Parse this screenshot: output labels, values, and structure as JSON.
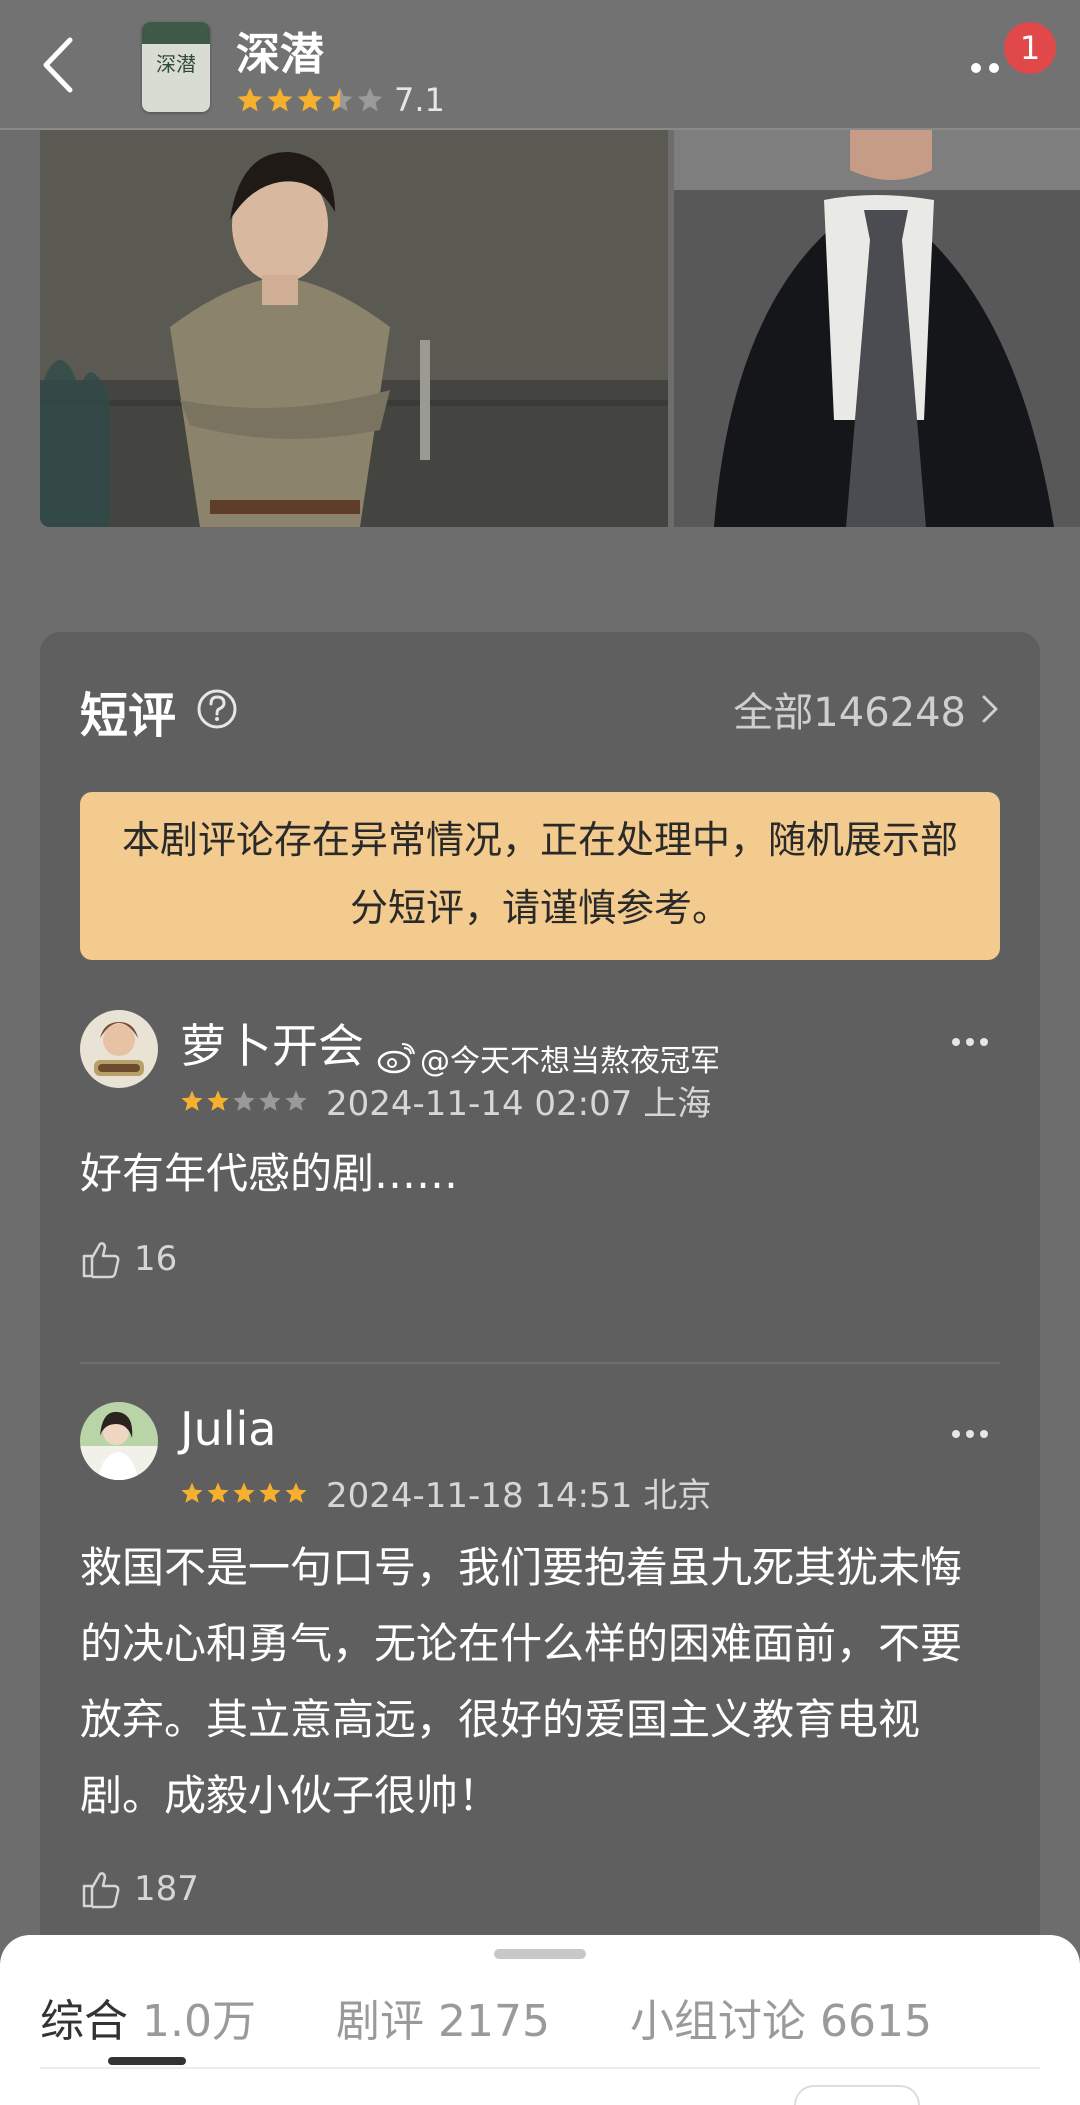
{
  "header": {
    "title": "深潜",
    "rating": "7.1",
    "stars": 3.5,
    "badge_count": "1",
    "app_icon_text": "深潜"
  },
  "short_reviews": {
    "title": "短评",
    "all_label": "全部146248",
    "notice": "本剧评论存在异常情况，正在处理中，随机展示部分短评，请谨慎参考。"
  },
  "reviews": [
    {
      "name": "萝卜开会",
      "stars": 2,
      "date": "2024-11-14 02:07 上海",
      "text": "好有年代感的剧……",
      "likes": "16"
    },
    {
      "name": "Julia",
      "stars": 5,
      "date": "2024-11-18 14:51 北京",
      "text": "救国不是一句口号，我们要抱着虽九死其犹未悔的决心和勇气，无论在什么样的困难面前，不要放弃。其立意高远，很好的爱国主义教育电视剧。成毅小伙子很帅！",
      "likes": "187"
    }
  ],
  "watermark": "@今天不想当熬夜冠军",
  "bottom_tabs": [
    {
      "label": "综合",
      "count": "1.0万"
    },
    {
      "label": "剧评",
      "count": "2175"
    },
    {
      "label": "小组讨论",
      "count": "6615"
    }
  ],
  "colors": {
    "star_on": "#f7b02e",
    "star_off": "#9a9a9a",
    "notice_bg": "#f3cb8e",
    "badge": "#e0484a"
  }
}
